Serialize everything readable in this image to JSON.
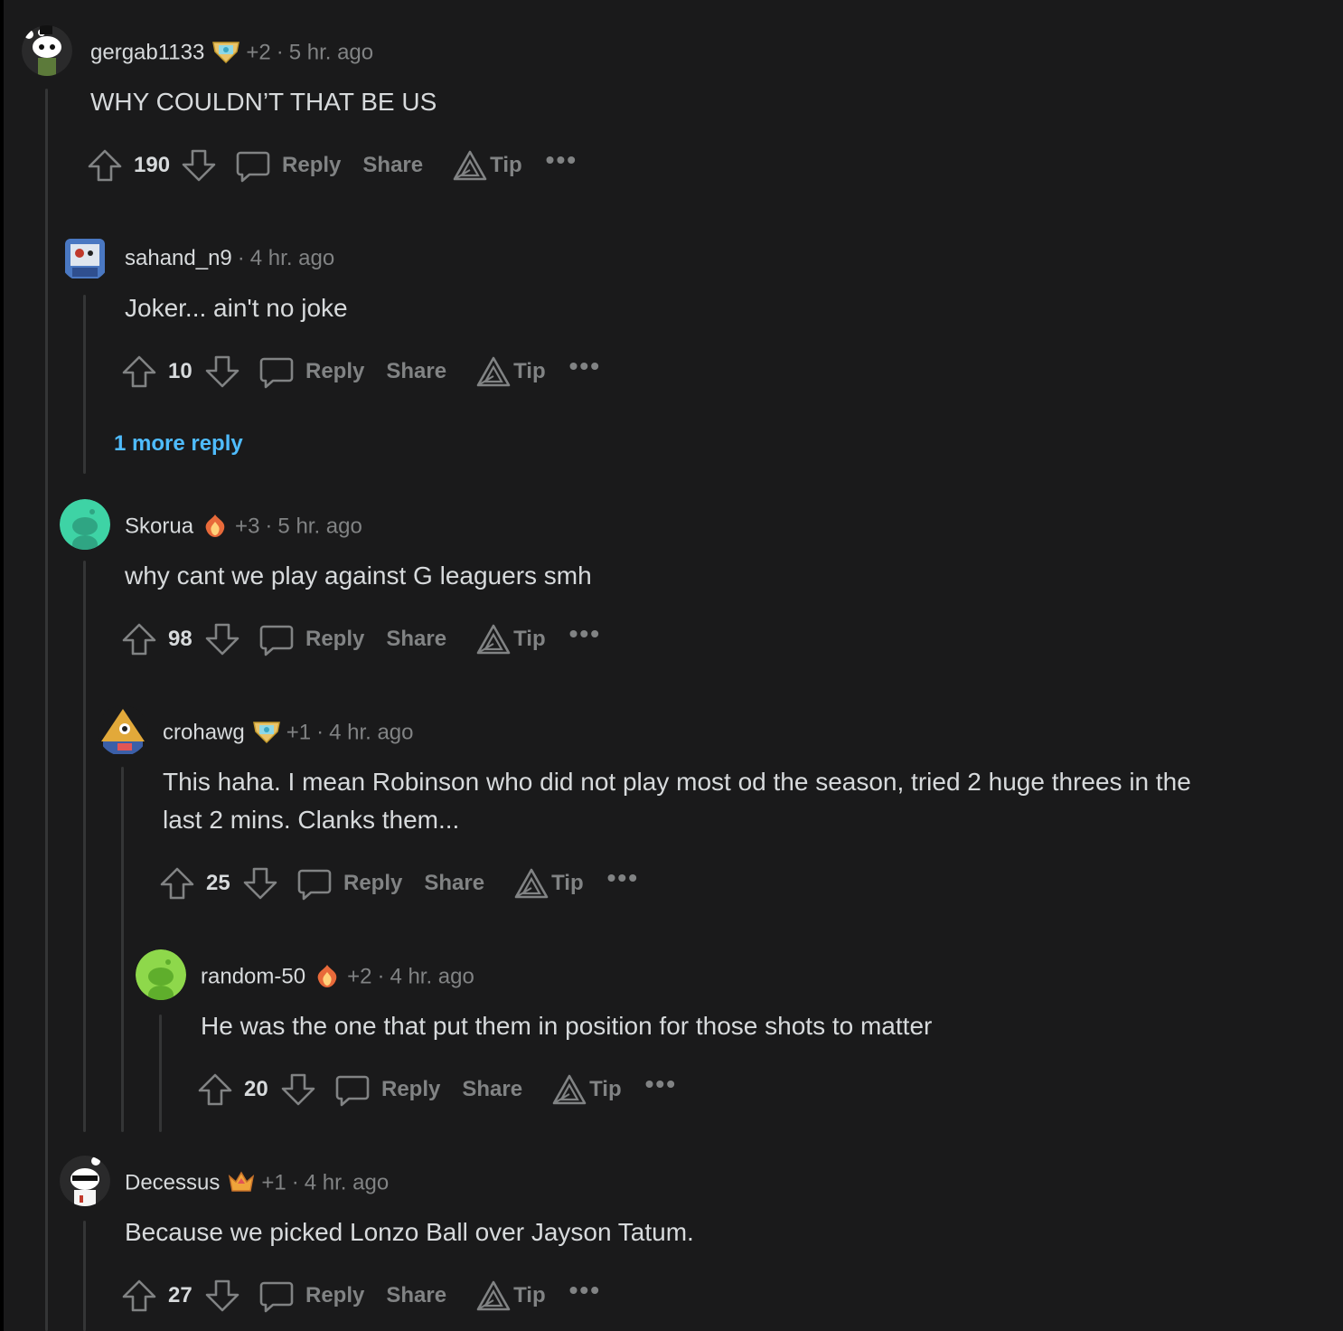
{
  "comments": [
    {
      "username": "gergab1133",
      "flair": "award-badge-icon",
      "awards": "+2",
      "time": "5 hr. ago",
      "body": "WHY COULDN’T THAT BE US",
      "score": "190"
    },
    {
      "username": "sahand_n9",
      "time": "4 hr. ago",
      "body": "Joker... ain't no joke",
      "score": "10",
      "more_replies": "1 more reply"
    },
    {
      "username": "Skorua",
      "flair": "award-fire-icon",
      "awards": "+3",
      "time": "5 hr. ago",
      "body": "why cant we play against G leaguers smh",
      "score": "98"
    },
    {
      "username": "crohawg",
      "flair": "award-badge-icon",
      "awards": "+1",
      "time": "4 hr. ago",
      "body": "This haha. I mean Robinson who did not play most od the season, tried 2 huge threes in the last 2 mins. Clanks them...",
      "score": "25"
    },
    {
      "username": "random-50",
      "flair": "award-fire-icon",
      "awards": "+2",
      "time": "4 hr. ago",
      "body": "He was the one that put them in position for those shots to matter",
      "score": "20"
    },
    {
      "username": "Decessus",
      "flair": "award-crown-icon",
      "awards": "+1",
      "time": "4 hr. ago",
      "body": "Because we picked Lonzo Ball over Jayson Tatum.",
      "score": "27"
    }
  ],
  "actions": {
    "reply": "Reply",
    "share": "Share",
    "tip": "Tip",
    "more": "•••"
  },
  "colors": {
    "background": "#1a1a1b",
    "text": "#d7dadc",
    "muted": "#818384",
    "link": "#4fbcff",
    "thread_line": "#343536"
  }
}
